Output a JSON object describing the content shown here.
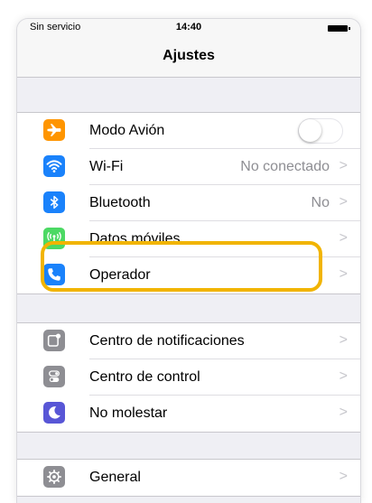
{
  "status_bar": {
    "carrier": "Sin servicio",
    "time": "14:40"
  },
  "nav": {
    "title": "Ajustes"
  },
  "group1": [
    {
      "id": "airplane",
      "label": "Modo Avión",
      "icon": "airplane-icon",
      "color": "#ff9500",
      "control": "toggle",
      "toggle_on": false
    },
    {
      "id": "wifi",
      "label": "Wi-Fi",
      "value": "No conectado",
      "icon": "wifi-icon",
      "color": "#1a82fb"
    },
    {
      "id": "bluetooth",
      "label": "Bluetooth",
      "value": "No",
      "icon": "bluetooth-icon",
      "color": "#1a82fb"
    },
    {
      "id": "cellular",
      "label": "Datos móviles",
      "value": "",
      "icon": "cellular-icon",
      "color": "#4cd964"
    },
    {
      "id": "carrier",
      "label": "Operador",
      "value": "",
      "icon": "phone-icon",
      "color": "#1a82fb"
    }
  ],
  "group2": [
    {
      "id": "notifications",
      "label": "Centro de notificaciones",
      "icon": "notifications-icon",
      "color": "#8e8e93"
    },
    {
      "id": "control-center",
      "label": "Centro de control",
      "icon": "control-center-icon",
      "color": "#8e8e93"
    },
    {
      "id": "do-not-disturb",
      "label": "No molestar",
      "icon": "moon-icon",
      "color": "#5856d6"
    }
  ],
  "group3": [
    {
      "id": "general",
      "label": "General",
      "icon": "gear-icon",
      "color": "#8e8e93"
    }
  ],
  "chevron": ">",
  "highlight_color": "#f1b400"
}
